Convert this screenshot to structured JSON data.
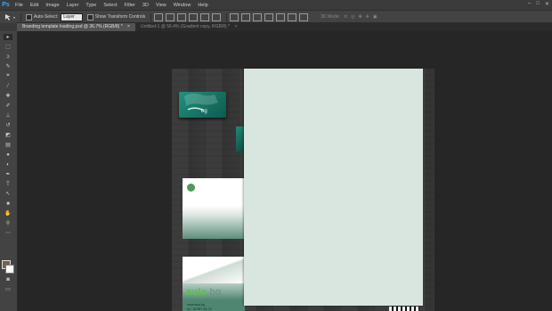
{
  "app": {
    "logo": "Ps"
  },
  "menu": {
    "items": [
      "File",
      "Edit",
      "Image",
      "Layer",
      "Type",
      "Select",
      "Filter",
      "3D",
      "View",
      "Window",
      "Help"
    ]
  },
  "window_controls": {
    "minimize": "–",
    "restore": "□",
    "close": "✕"
  },
  "options_bar": {
    "tool_icon": "move-icon",
    "auto_select_label": "Auto-Select:",
    "auto_select_value": "Layer",
    "show_transform_label": "Show Transform Controls",
    "mode_3d_label": "3D Mode:"
  },
  "tabs": [
    {
      "label": "Branding template loading.psd @ 36.7% (RGB/8) *",
      "close": "×",
      "active": true
    },
    {
      "label": "Untitled-1 @ 56.4% (Gradient copy, RGB/8) *",
      "close": "×",
      "active": false
    }
  ],
  "toolbar": {
    "tools": [
      "move-icon",
      "marquee-icon",
      "lasso-icon",
      "quick-select-icon",
      "crop-icon",
      "eyedropper-icon",
      "healing-icon",
      "brush-icon",
      "stamp-icon",
      "history-brush-icon",
      "eraser-icon",
      "gradient-icon",
      "blur-icon",
      "dodge-icon",
      "pen-icon",
      "type-icon",
      "path-select-icon",
      "shape-icon",
      "hand-icon",
      "zoom-icon",
      "extra-icon"
    ]
  },
  "swatches": {
    "foreground": "#77624d",
    "background": "#ffffff"
  },
  "canvas": {
    "card_brand": "bg",
    "envelope_brand_main": "aula",
    "envelope_brand_tld": ".bg",
    "envelope_web": "www.aula.bg",
    "envelope_tel": "tel.: 02/987-65-75"
  }
}
